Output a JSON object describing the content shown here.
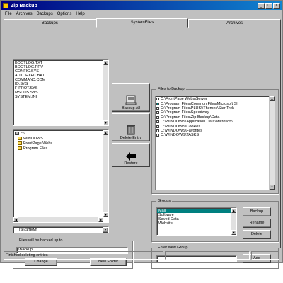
{
  "window": {
    "title": "Zip Backup",
    "minimize": "_",
    "maximize": "□",
    "close": "×"
  },
  "menu": [
    "File",
    "Archives",
    "Backups",
    "Options",
    "Help"
  ],
  "tabs": [
    {
      "label": "Backups",
      "active": false
    },
    {
      "label": "SystemFiles",
      "active": true
    },
    {
      "label": "Archives",
      "active": false
    }
  ],
  "system_files": [
    "BOOTLOG.TXT",
    "BOOTLOG.PRV",
    "CONFIG.SYS",
    "AUTOEXEC.BAT",
    "COMMAND.COM",
    "IO.SYS",
    "F-PROT.SYS",
    "MSDOS.SYS",
    "SYSTEM.INI"
  ],
  "folders": [
    {
      "label": "c:\\",
      "icon": "drive-icon"
    },
    {
      "label": "WINDOWS",
      "icon": "folder-icon"
    },
    {
      "label": "FrontPage Webs",
      "icon": "folder-icon"
    },
    {
      "label": "Program Files",
      "icon": "folder-icon"
    }
  ],
  "drive_select": "[SYSTEM]",
  "center_buttons": [
    {
      "label": "Backup All",
      "icon": "backup-icon"
    },
    {
      "label": "Delete Entry",
      "icon": "trash-icon"
    },
    {
      "label": "Restore",
      "icon": "restore-icon"
    }
  ],
  "files_panel": {
    "label": "Files to Backup",
    "items": [
      {
        "path": "C:\\FrontPage Webs\\Server",
        "checked": false
      },
      {
        "path": "C:\\Program Files\\Common Files\\Microsoft Sh",
        "checked": true
      },
      {
        "path": "C:\\Program Files\\PLUS!\\Themes\\Star Trek",
        "checked": false
      },
      {
        "path": "C:\\Program Files\\Speedway",
        "checked": false
      },
      {
        "path": "C:\\Program Files\\Zip Backup\\Data",
        "checked": false
      },
      {
        "path": "C:\\WINDOWS\\Application Data\\Microsoft\\",
        "checked": false
      },
      {
        "path": "C:\\WINDOWS\\Cookies",
        "checked": false
      },
      {
        "path": "C:\\WINDOWS\\Favorites",
        "checked": false
      },
      {
        "path": "C:\\WINDOWS\\TASKS",
        "checked": false
      }
    ]
  },
  "groups": {
    "label": "Groups",
    "items": [
      "Mail",
      "Software",
      "Saved Data",
      "Website"
    ],
    "selected": 0,
    "buttons": [
      "Backup",
      "Rename",
      "Delete"
    ]
  },
  "backup_to": {
    "label": "Files will be backed up to",
    "value": "\\Backup",
    "change": "Change",
    "new_folder": "New Folder"
  },
  "new_group": {
    "label": "Enter New Group",
    "value": "",
    "add": "Add"
  },
  "status": {
    "message": "Finished deleting entries"
  }
}
